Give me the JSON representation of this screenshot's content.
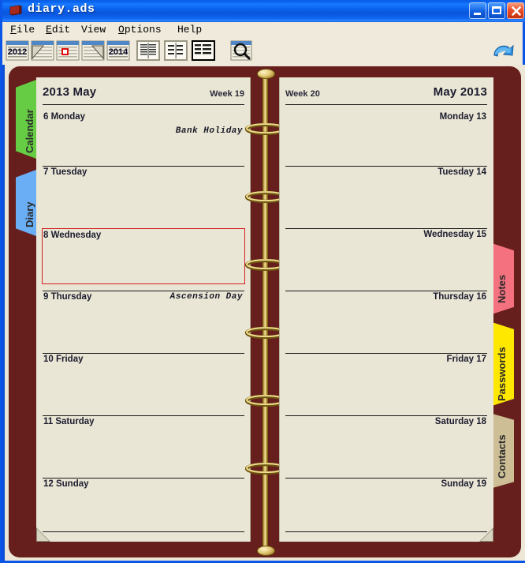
{
  "window": {
    "title": "diary.ads",
    "icon": "book-icon",
    "buttons": {
      "minimize": "minimize-button",
      "maximize": "maximize-button",
      "close": "close-button"
    }
  },
  "menu": [
    {
      "label": "File",
      "accel": "F"
    },
    {
      "label": "Edit",
      "accel": "E"
    },
    {
      "label": "View",
      "accel": ""
    },
    {
      "label": "Options",
      "accel": "O"
    },
    {
      "label": "Help",
      "accel": ""
    }
  ],
  "toolbar": {
    "items": [
      {
        "name": "prev-year-button",
        "label": "2012",
        "type": "calendar-year"
      },
      {
        "name": "prev-month-button",
        "label": "",
        "type": "calendar-prev"
      },
      {
        "name": "today-button",
        "label": "",
        "type": "calendar-today"
      },
      {
        "name": "next-month-button",
        "label": "",
        "type": "calendar-next"
      },
      {
        "name": "next-year-button",
        "label": "2014",
        "type": "calendar-year"
      }
    ],
    "views": [
      {
        "name": "view-day-button",
        "active": false
      },
      {
        "name": "view-week-button",
        "active": false
      },
      {
        "name": "view-list-button",
        "active": true
      }
    ],
    "search": {
      "name": "search-button",
      "label": ""
    },
    "undo": {
      "name": "undo-button",
      "label": ""
    }
  },
  "left_tabs": [
    {
      "label": "Calendar",
      "color": "#66cc44",
      "name": "tab-calendar"
    },
    {
      "label": "Diary",
      "color": "#6aaef5",
      "name": "tab-diary"
    }
  ],
  "right_tabs": [
    {
      "label": "Notes",
      "color": "#f4717f",
      "name": "tab-notes"
    },
    {
      "label": "Passwords",
      "color": "#ffe800",
      "name": "tab-passwords"
    },
    {
      "label": "Contacts",
      "color": "#cdbe96",
      "name": "tab-contacts"
    }
  ],
  "left_page": {
    "title": "2013 May",
    "week": "Week 19",
    "days": [
      {
        "label": "6 Monday",
        "note": "Bank Holiday",
        "selected": false
      },
      {
        "label": "7 Tuesday",
        "note": "",
        "selected": false
      },
      {
        "label": "8 Wednesday",
        "note": "",
        "selected": true
      },
      {
        "label": "9 Thursday",
        "note": "Ascension Day",
        "selected": false
      },
      {
        "label": "10 Friday",
        "note": "",
        "selected": false
      },
      {
        "label": "11 Saturday",
        "note": "",
        "selected": false
      },
      {
        "label": "12 Sunday",
        "note": "",
        "selected": false
      }
    ]
  },
  "right_page": {
    "title": "May 2013",
    "week": "Week 20",
    "days": [
      {
        "label": "Monday 13",
        "note": "",
        "selected": false
      },
      {
        "label": "Tuesday 14",
        "note": "",
        "selected": false
      },
      {
        "label": "Wednesday 15",
        "note": "",
        "selected": false
      },
      {
        "label": "Thursday 16",
        "note": "",
        "selected": false
      },
      {
        "label": "Friday 17",
        "note": "",
        "selected": false
      },
      {
        "label": "Saturday 18",
        "note": "",
        "selected": false
      },
      {
        "label": "Sunday 19",
        "note": "",
        "selected": false
      }
    ]
  },
  "colors": {
    "binder": "#661F1C",
    "page": "#EAE6D5",
    "selection": "#d21f1f",
    "titlebar": "#0b4fd8",
    "ring": "#d9bf63"
  }
}
